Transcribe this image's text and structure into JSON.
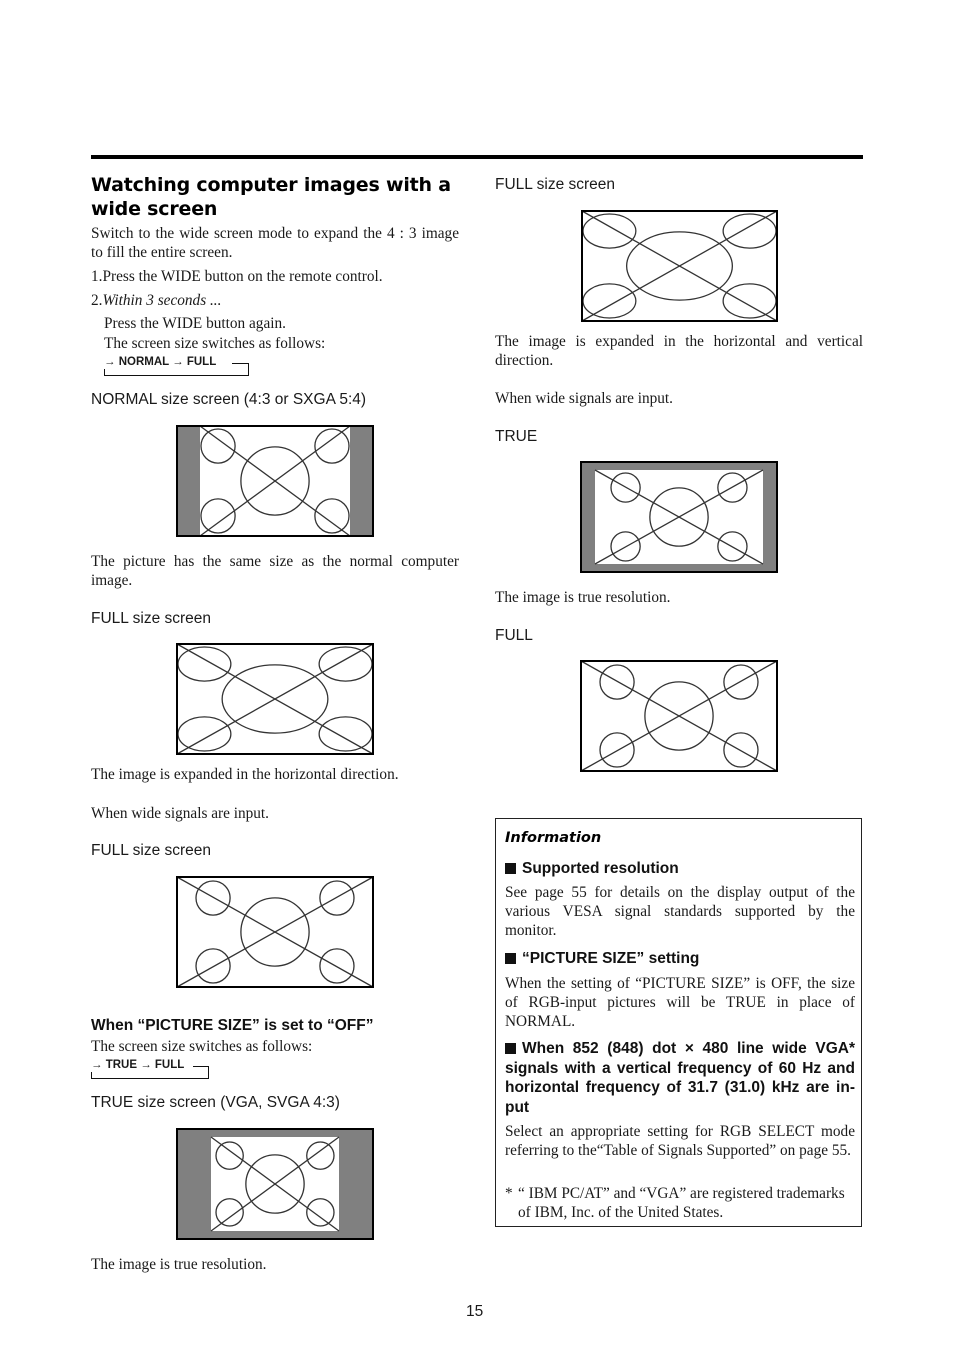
{
  "page": {
    "number": "15"
  },
  "left": {
    "heading": "Watching computer images with a wide screen",
    "intro": "Switch to the wide screen mode to expand the 4 : 3 image to fill the entire screen.",
    "steps": [
      {
        "num": "1.",
        "text": "Press the WIDE button on the remote control."
      },
      {
        "num": "2.",
        "text": "Within 3 seconds ..."
      }
    ],
    "step2_lines": [
      "Press the WIDE button again.",
      "The screen size switches as follows:"
    ],
    "cycle1": "→ NORMAL → FULL",
    "normal_label": "NORMAL size screen (4:3 or SXGA 5:4)",
    "normal_desc": "The picture has the same size as the normal computer image.",
    "full_label": "FULL size screen",
    "full_desc": "The image is expanded in the horizontal direction.",
    "wide_note": "When wide signals are input.",
    "full_label_2": "FULL size screen",
    "off_heading": "When “PICTURE SIZE” is set to “OFF”",
    "off_intro": "The screen size switches as follows:",
    "cycle2": "→ TRUE → FULL",
    "true_label": "TRUE size screen (VGA, SVGA 4:3)",
    "true_desc": "The image is true resolution."
  },
  "right": {
    "full_label": "FULL size screen",
    "full_desc": "The image is expanded in the horizontal and vertical direction.",
    "wide_note": "When wide signals are input.",
    "true_label": "TRUE",
    "true_desc": "The image is true resolution.",
    "full_label_2": "FULL"
  },
  "info": {
    "title": "Information",
    "sections": [
      {
        "heading": "Supported resolution",
        "body": "See page 55 for details on the display output of the various VESA signal standards supported by the monitor."
      },
      {
        "heading": "“PICTURE SIZE” setting",
        "body": "When the setting of “PICTURE SIZE” is OFF, the size of RGB-input pictures will be TRUE in place of NORMAL."
      },
      {
        "heading": "When 852 (848) dot × 480 line wide VGA* signals with a vertical frequency of 60 Hz and horizontal frequency of 31.7 (31.0) kHz are in-put",
        "body": "Select an appropriate setting for RGB SELECT mode referring to the“Table of Signals Supported” on page 55."
      }
    ],
    "footnote_mark": "*",
    "footnote": "“ IBM PC/AT” and “VGA” are registered trademarks of IBM, Inc. of the United States."
  },
  "colors": {
    "letterbox": "#808080",
    "rule": "#000000",
    "line": "#333333"
  }
}
